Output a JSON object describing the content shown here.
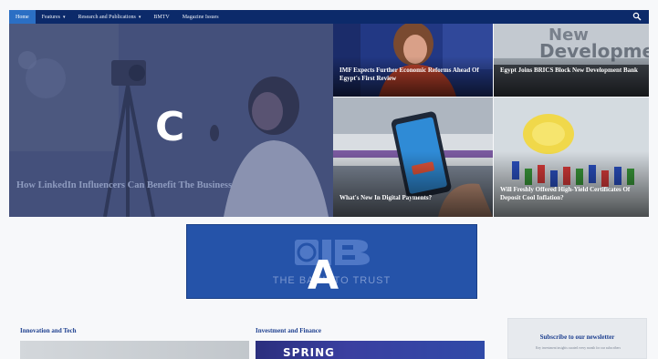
{
  "colors": {
    "nav_bg": "#0c2a6a",
    "nav_active": "#2b6fc4",
    "ad_bg": "#2553a9",
    "section_heading": "#1d3f8f"
  },
  "nav": {
    "items": [
      {
        "label": "Home",
        "active": true,
        "has_caret": false
      },
      {
        "label": "Features",
        "active": false,
        "has_caret": true
      },
      {
        "label": "Research and Publications",
        "active": false,
        "has_caret": true
      },
      {
        "label": "BMTV",
        "active": false,
        "has_caret": false
      },
      {
        "label": "Magazine Issues",
        "active": false,
        "has_caret": false
      }
    ],
    "caret": "▾",
    "search_icon": "search-icon"
  },
  "hero": {
    "title": "How LinkedIn Influencers Can Benefit The Business",
    "badge": "C"
  },
  "cards": [
    {
      "title": "IMF Expects Further Economic Reforms Ahead Of Egypt's First Review"
    },
    {
      "title": "Egypt Joins BRICS Block New Development Bank"
    },
    {
      "title": "What's New In Digital Payments?"
    },
    {
      "title": "Will Freshly Offered High-Yield Certificates Of Deposit Cool Inflation?"
    }
  ],
  "ad": {
    "slogan": "THE BANK TO TRUST",
    "badge": "A"
  },
  "sections": [
    {
      "heading": "Innovation and Tech"
    },
    {
      "heading": "Investment and Finance",
      "image_text": "SPRING"
    }
  ],
  "newsletter": {
    "title": "Subscribe to our newsletter",
    "subtitle": "Key investment insights curated every month for our subscribers"
  }
}
